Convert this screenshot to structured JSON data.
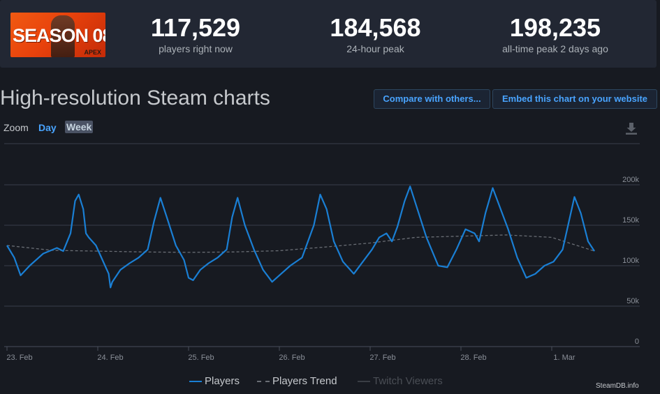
{
  "header": {
    "logo_text": "SEASON 08",
    "logo_sub": "APEX",
    "stats": [
      {
        "value": "117,529",
        "label": "players right now"
      },
      {
        "value": "184,568",
        "label": "24-hour peak"
      },
      {
        "value": "198,235",
        "label": "all-time peak 2 days ago"
      }
    ]
  },
  "section": {
    "title": "High-resolution Steam charts",
    "compare_label": "Compare with others...",
    "embed_label": "Embed this chart on your website"
  },
  "zoom": {
    "label": "Zoom",
    "day": "Day",
    "week": "Week",
    "selected": "Week"
  },
  "icons": {
    "download": "download-icon"
  },
  "colors": {
    "players": "#1a7fd4",
    "trend": "#6a6e75",
    "accent": "#49a4ff"
  },
  "credit": "SteamDB.info",
  "chart_data": {
    "type": "line",
    "title": "",
    "xlabel": "",
    "ylabel": "",
    "x_ticks": [
      "23. Feb",
      "24. Feb",
      "25. Feb",
      "26. Feb",
      "27. Feb",
      "28. Feb",
      "1. Mar"
    ],
    "y_ticks": [
      "0",
      "50k",
      "100k",
      "150k",
      "200k"
    ],
    "ylim": [
      0,
      200000
    ],
    "grid": true,
    "legend": "bottom-center",
    "series": [
      {
        "name": "Players",
        "points": [
          [
            0.0,
            125000
          ],
          [
            0.08,
            110000
          ],
          [
            0.15,
            88000
          ],
          [
            0.25,
            100000
          ],
          [
            0.4,
            115000
          ],
          [
            0.55,
            122000
          ],
          [
            0.62,
            118000
          ],
          [
            0.7,
            140000
          ],
          [
            0.75,
            180000
          ],
          [
            0.79,
            188000
          ],
          [
            0.84,
            170000
          ],
          [
            0.87,
            140000
          ],
          [
            0.9,
            135000
          ],
          [
            0.98,
            125000
          ],
          [
            1.08,
            100000
          ],
          [
            1.12,
            90000
          ],
          [
            1.14,
            73000
          ],
          [
            1.16,
            80000
          ],
          [
            1.25,
            95000
          ],
          [
            1.35,
            103000
          ],
          [
            1.45,
            110000
          ],
          [
            1.55,
            120000
          ],
          [
            1.62,
            155000
          ],
          [
            1.69,
            184000
          ],
          [
            1.76,
            160000
          ],
          [
            1.86,
            125000
          ],
          [
            1.95,
            107000
          ],
          [
            2.0,
            85000
          ],
          [
            2.05,
            82000
          ],
          [
            2.13,
            95000
          ],
          [
            2.22,
            103000
          ],
          [
            2.32,
            110000
          ],
          [
            2.42,
            120000
          ],
          [
            2.48,
            160000
          ],
          [
            2.54,
            184000
          ],
          [
            2.62,
            150000
          ],
          [
            2.72,
            120000
          ],
          [
            2.82,
            95000
          ],
          [
            2.92,
            80000
          ],
          [
            3.02,
            90000
          ],
          [
            3.12,
            100000
          ],
          [
            3.25,
            110000
          ],
          [
            3.38,
            150000
          ],
          [
            3.45,
            188000
          ],
          [
            3.52,
            170000
          ],
          [
            3.6,
            130000
          ],
          [
            3.7,
            105000
          ],
          [
            3.82,
            90000
          ],
          [
            3.92,
            105000
          ],
          [
            4.02,
            120000
          ],
          [
            4.1,
            135000
          ],
          [
            4.18,
            140000
          ],
          [
            4.24,
            130000
          ],
          [
            4.3,
            148000
          ],
          [
            4.38,
            180000
          ],
          [
            4.44,
            198000
          ],
          [
            4.52,
            170000
          ],
          [
            4.62,
            135000
          ],
          [
            4.75,
            100000
          ],
          [
            4.85,
            98000
          ],
          [
            4.95,
            120000
          ],
          [
            5.05,
            145000
          ],
          [
            5.15,
            140000
          ],
          [
            5.2,
            130000
          ],
          [
            5.27,
            165000
          ],
          [
            5.35,
            196000
          ],
          [
            5.42,
            175000
          ],
          [
            5.52,
            145000
          ],
          [
            5.62,
            110000
          ],
          [
            5.72,
            85000
          ],
          [
            5.82,
            90000
          ],
          [
            5.92,
            100000
          ],
          [
            6.02,
            105000
          ],
          [
            6.12,
            120000
          ],
          [
            6.18,
            150000
          ],
          [
            6.25,
            185000
          ],
          [
            6.32,
            165000
          ],
          [
            6.4,
            130000
          ],
          [
            6.47,
            118000
          ]
        ]
      },
      {
        "name": "Players Trend",
        "points": [
          [
            0.0,
            125000
          ],
          [
            0.5,
            119000
          ],
          [
            1.0,
            118000
          ],
          [
            1.5,
            117000
          ],
          [
            2.0,
            116500
          ],
          [
            2.5,
            117000
          ],
          [
            3.0,
            118500
          ],
          [
            3.5,
            123000
          ],
          [
            4.0,
            128000
          ],
          [
            4.5,
            135000
          ],
          [
            5.0,
            136500
          ],
          [
            5.5,
            138000
          ],
          [
            6.0,
            135000
          ],
          [
            6.47,
            118000
          ]
        ]
      },
      {
        "name": "Twitch Viewers",
        "points": []
      }
    ]
  }
}
